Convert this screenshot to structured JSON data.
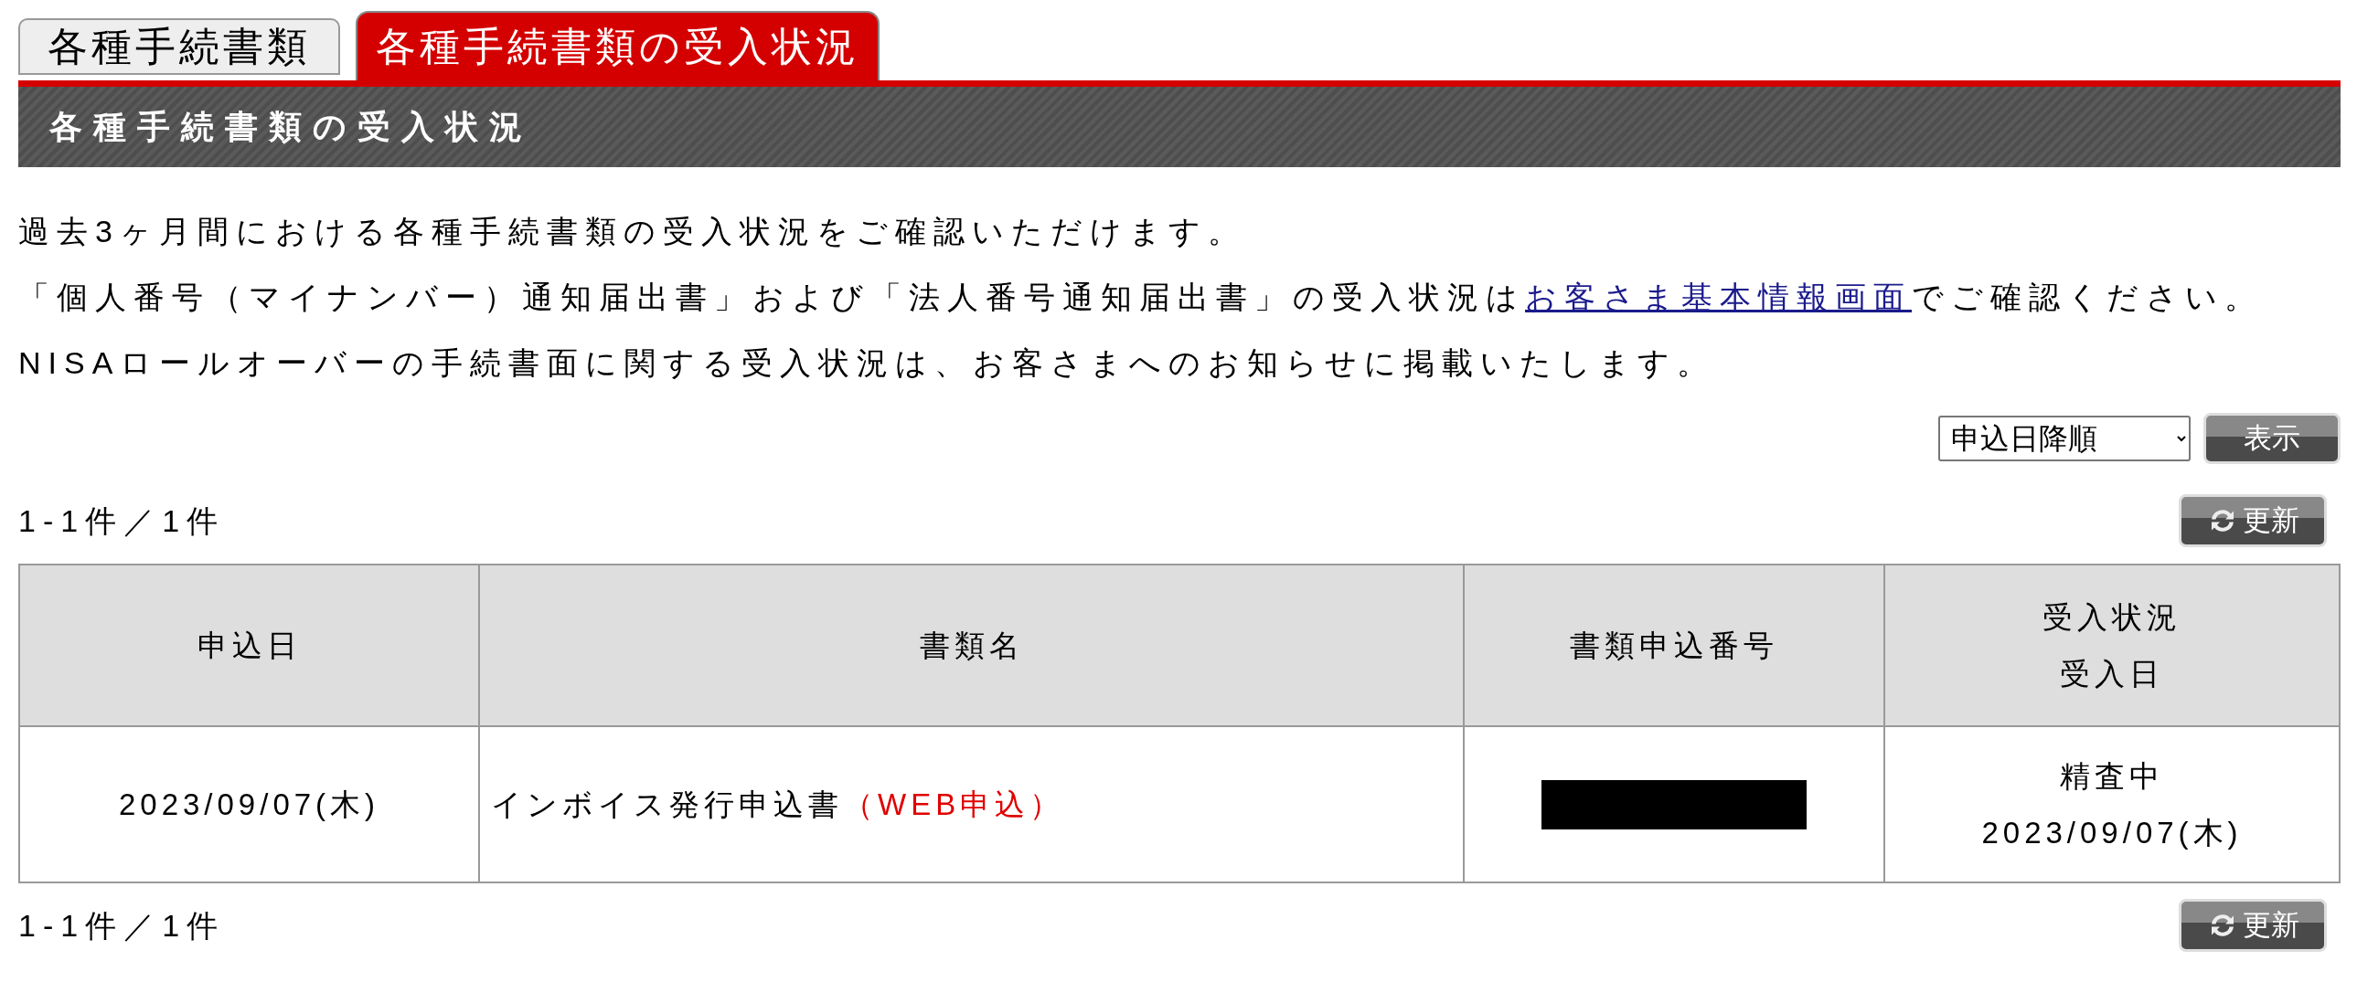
{
  "tabs": [
    {
      "label": "各種手続書類",
      "selected": false
    },
    {
      "label": "各種手続書類の受入状況",
      "selected": true
    }
  ],
  "section_title": "各種手続書類の受入状況",
  "notes": [
    {
      "before": "過去3ヶ月間における各種手続書類の受入状況をご確認いただけます。"
    },
    {
      "before": "「個人番号（マイナンバー）通知届出書」および「法人番号通知届出書」の受入状況は",
      "link": "お客さま基本情報画面",
      "after": "でご確認ください。"
    },
    {
      "before": "NISAロールオーバーの手続書面に関する受入状況は、お客さまへのお知らせに掲載いたします。"
    }
  ],
  "sort": {
    "value": "申込日降順",
    "button": "表示"
  },
  "count_top": "1-1件／1件",
  "refresh_top": "更新",
  "table": {
    "columns": [
      {
        "label": "申込日"
      },
      {
        "label": "書類名"
      },
      {
        "label": "書類申込番号"
      },
      {
        "label": "受入状況",
        "sublabel": "受入日"
      }
    ],
    "rows": [
      {
        "date": "2023/09/07(木)",
        "document": "インボイス発行申込書",
        "channel": "（WEB申込）",
        "number_redacted": true,
        "status": "精査中",
        "received": "2023/09/07(木)"
      }
    ]
  },
  "count_bottom": "1-1件／1件",
  "refresh_bottom": "更新"
}
